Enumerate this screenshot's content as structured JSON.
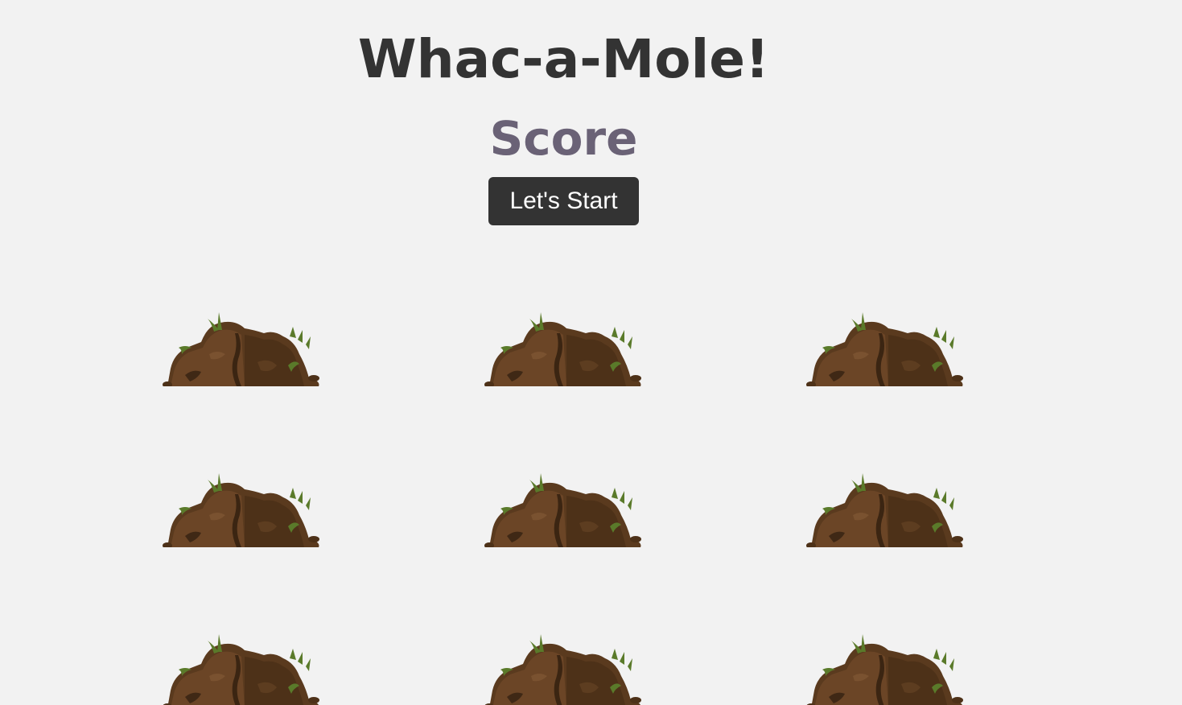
{
  "game": {
    "title": "Whac-a-Mole!",
    "score_label": "Score",
    "start_button_label": "Let's Start"
  },
  "board": {
    "rows": 3,
    "columns": 3,
    "holes": [
      {
        "id": 1,
        "mole_visible": false
      },
      {
        "id": 2,
        "mole_visible": false
      },
      {
        "id": 3,
        "mole_visible": false
      },
      {
        "id": 4,
        "mole_visible": false
      },
      {
        "id": 5,
        "mole_visible": false
      },
      {
        "id": 6,
        "mole_visible": false
      },
      {
        "id": 7,
        "mole_visible": false
      },
      {
        "id": 8,
        "mole_visible": false
      },
      {
        "id": 9,
        "mole_visible": false
      }
    ],
    "dirt_color": "#5a3a1e",
    "grass_color": "#5a7a2a"
  },
  "colors": {
    "background": "#f2f2f2",
    "title": "#333333",
    "score": "#6a6276",
    "button_bg": "#333333",
    "button_text": "#ffffff"
  }
}
